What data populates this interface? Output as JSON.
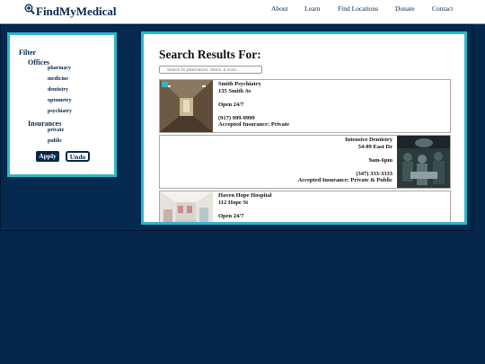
{
  "header": {
    "logo_text": "FindMyMedical",
    "nav": [
      "About",
      "Learn",
      "Find Locations",
      "Donate",
      "Contact"
    ]
  },
  "filter": {
    "title": "Filter",
    "offices_label": "Offices",
    "offices": [
      "pharmacy",
      "medicine",
      "dentistry",
      "optometry",
      "psychiatry"
    ],
    "insurances_label": "Insurances",
    "insurances": [
      "private",
      "public"
    ],
    "apply_label": "Apply",
    "undo_label": "Undo"
  },
  "results": {
    "title": "Search Results For:",
    "search_placeholder": "Search for pharmacies, clinics, & more...",
    "cards": [
      {
        "name": "Smith Psychiatry",
        "address": "135 Smith Av",
        "hours": "Open 24/7",
        "phone": "(917) 999-9999",
        "insurance": "Accepted Insurance: Private"
      },
      {
        "name": "Intensive Dentistry",
        "address": "54-89 East Dr",
        "hours": "9am-6pm",
        "phone": "(347) 333-3333",
        "insurance": "Accepted Insurance: Private & Public"
      },
      {
        "name": "Haven Hope Hospital",
        "address": "112 Hope St",
        "hours": "Open 24/7",
        "phone": "",
        "insurance": ""
      }
    ]
  },
  "colors": {
    "navy": "#04264a",
    "accent": "#2bb8c8",
    "white": "#ffffff"
  },
  "icons": [
    "magnifier-icon"
  ]
}
